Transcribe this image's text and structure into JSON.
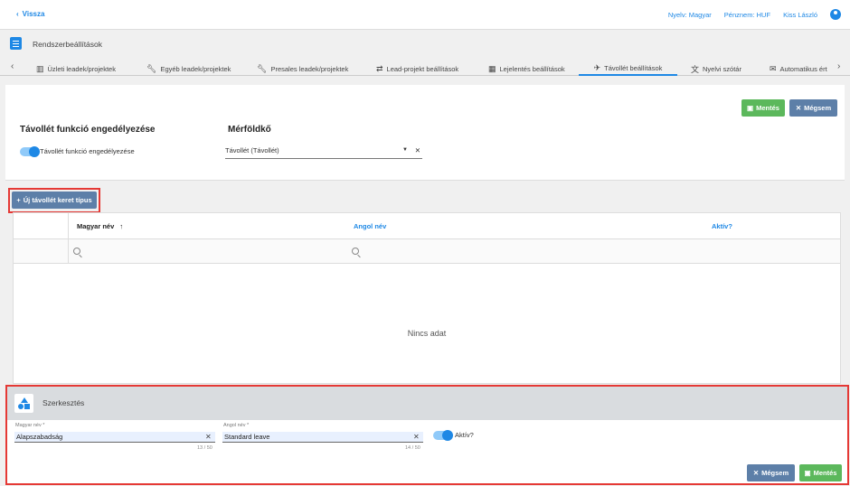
{
  "topbar": {
    "back_label": "Vissza",
    "language": "Nyelv: Magyar",
    "currency": "Pénznem: HUF",
    "user": "Kiss László"
  },
  "page_title": "Rendszerbeállítások",
  "tabs": [
    {
      "label": "Üzleti leadek/projektek",
      "icon": "building-icon"
    },
    {
      "label": "Egyéb leadek/projektek",
      "icon": "wrench-icon"
    },
    {
      "label": "Presales leadek/projektek",
      "icon": "wrench-icon"
    },
    {
      "label": "Lead-projekt beállítások",
      "icon": "swap-icon"
    },
    {
      "label": "Lejelentés beállítások",
      "icon": "calendar-icon"
    },
    {
      "label": "Távollét beállítások",
      "icon": "plane-icon",
      "active": true
    },
    {
      "label": "Nyelvi szótár",
      "icon": "translate-icon"
    },
    {
      "label": "Automatikus ért",
      "icon": "mail-icon"
    }
  ],
  "settings": {
    "save_label": "Mentés",
    "cancel_label": "Mégsem",
    "feature_title": "Távollét funkció engedélyezése",
    "feature_toggle_label": "Távollét funkció engedélyezése",
    "milestone_title": "Mérföldkő",
    "milestone_value": "Távollét (Távollét)"
  },
  "add_button_label": "Új távollét keret típus",
  "grid": {
    "columns": [
      "Magyar név",
      "Angol név",
      "Aktív?"
    ],
    "sort_indicator": "↑",
    "empty_text": "Nincs adat"
  },
  "edit": {
    "title": "Szerkesztés",
    "hu_label": "Magyar név *",
    "hu_value": "Alapszabadság",
    "hu_counter": "13 / 50",
    "en_label": "Angol név *",
    "en_value": "Standard leave",
    "en_counter": "14 / 50",
    "active_label": "Aktív?",
    "cancel_label": "Mégsem",
    "save_label": "Mentés"
  },
  "colors": {
    "accent": "#1e88e5",
    "save_green": "#5cb85c",
    "cancel_blue": "#5d7fa8",
    "highlight_red": "#e53935"
  }
}
